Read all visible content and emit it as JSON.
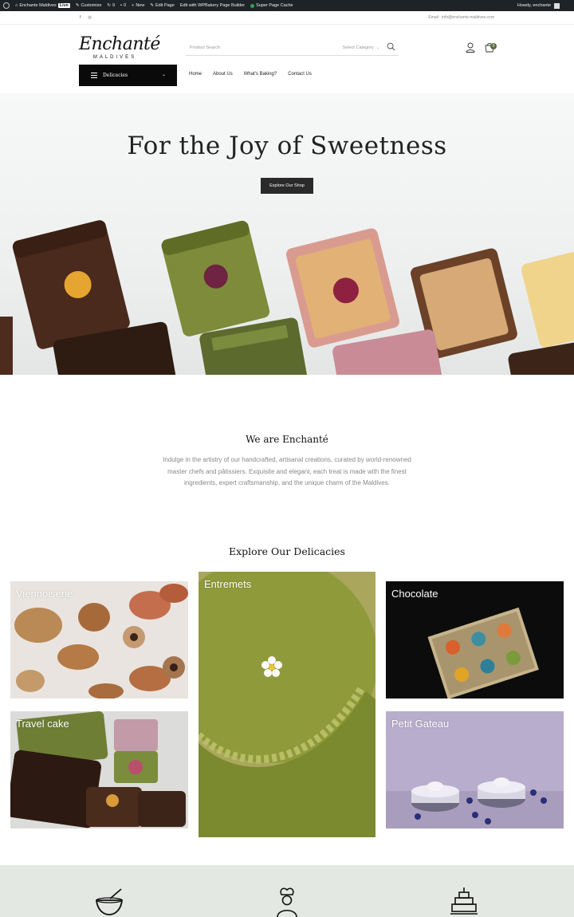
{
  "admin_bar": {
    "site_name": "Enchante Maldives",
    "live_badge": "Live",
    "customize": "Customize",
    "updates_count": "9",
    "comments_count": "0",
    "new": "New",
    "edit_page": "Edit Page",
    "edit_with": "Edit with WPBakery Page Builder",
    "cache": "Super Page Cache",
    "greeting": "Howdy, enchante"
  },
  "topbar": {
    "social_icons": [
      "facebook-icon",
      "instagram-icon"
    ],
    "email": "Email : info@enchante-maldives.com"
  },
  "header": {
    "logo_script": "Enchanté",
    "logo_sub": "MALDIVES",
    "search_placeholder": "Product Search",
    "category_select": "Select Category",
    "cart_count": "0",
    "category_button": "Delicacies",
    "nav": [
      "Home",
      "About Us",
      "What's Baking?",
      "Contact Us"
    ]
  },
  "hero": {
    "title": "For the Joy of Sweetness",
    "cta": "Explore Our Shop"
  },
  "intro": {
    "title": "We are Enchanté",
    "text": "Indulge in the artistry of our handcrafted, artisanal creations, curated by world-renowned master chefs and pâtissiers. Exquisite and elegant, each treat is made with the finest ingredients, expert craftsmanship, and the unique charm of the Maldives."
  },
  "explore": {
    "title": "Explore Our Delicacies",
    "tiles": [
      "Viennoiserie",
      "Entremets",
      "Chocolate",
      "Travel cake",
      "Petit Gateau"
    ]
  },
  "colors": {
    "accent": "#5b6b3d",
    "admin_bar": "#1d2327",
    "band": "#e4e8e2"
  }
}
